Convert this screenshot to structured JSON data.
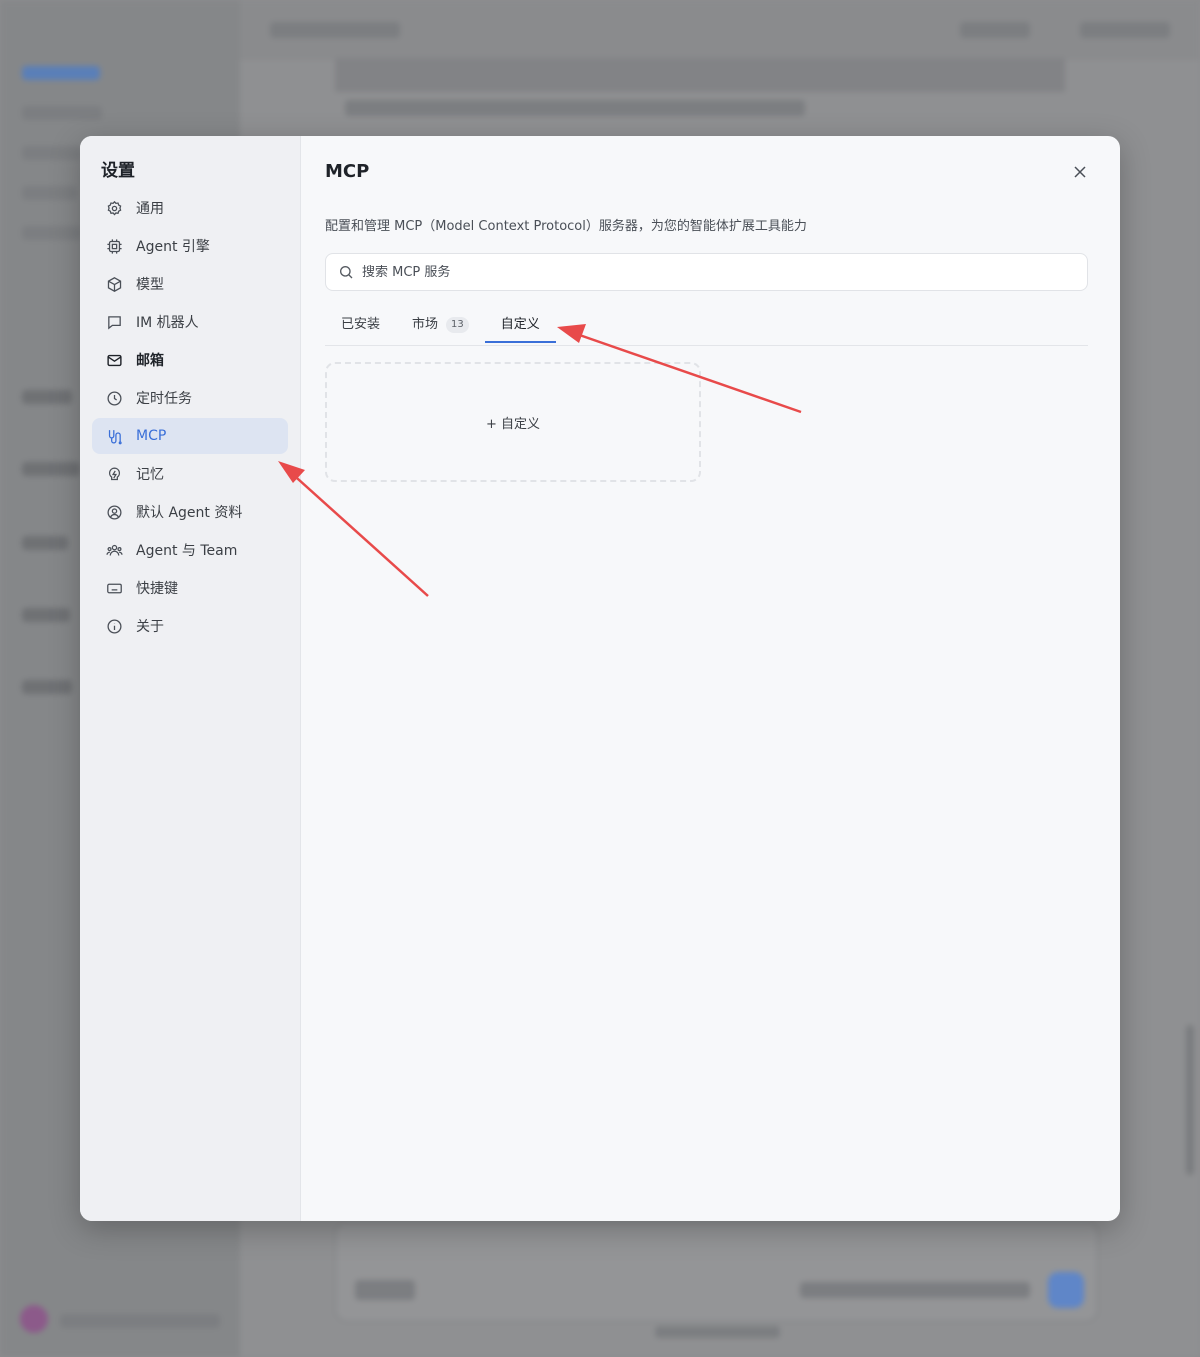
{
  "dialog": {
    "sidebar_title": "设置",
    "nav": [
      {
        "label": "通用",
        "icon": "gear-icon"
      },
      {
        "label": "Agent 引擎",
        "icon": "chip-icon"
      },
      {
        "label": "模型",
        "icon": "cube-icon"
      },
      {
        "label": "IM 机器人",
        "icon": "chat-bubble-icon"
      },
      {
        "label": "邮箱",
        "icon": "mail-icon"
      },
      {
        "label": "定时任务",
        "icon": "clock-icon"
      },
      {
        "label": "MCP",
        "icon": "mcp-icon"
      },
      {
        "label": "记忆",
        "icon": "memory-icon"
      },
      {
        "label": "默认 Agent 资料",
        "icon": "user-circle-icon"
      },
      {
        "label": "Agent 与 Team",
        "icon": "team-icon"
      },
      {
        "label": "快捷键",
        "icon": "keyboard-icon"
      },
      {
        "label": "关于",
        "icon": "info-icon"
      }
    ],
    "active_nav": "MCP",
    "title": "MCP",
    "description": "配置和管理 MCP（Model Context Protocol）服务器，为您的智能体扩展工具能力",
    "search": {
      "placeholder": "搜索 MCP 服务",
      "value": ""
    },
    "tabs": [
      {
        "label": "已安装",
        "badge": ""
      },
      {
        "label": "市场",
        "badge": "13"
      },
      {
        "label": "自定义",
        "badge": ""
      }
    ],
    "active_tab": "自定义",
    "add_custom_label": "+ 自定义"
  },
  "colors": {
    "accent": "#3a6fd8",
    "active_nav_bg": "#dde4f2",
    "annotation_arrow": "#e84a4a"
  }
}
